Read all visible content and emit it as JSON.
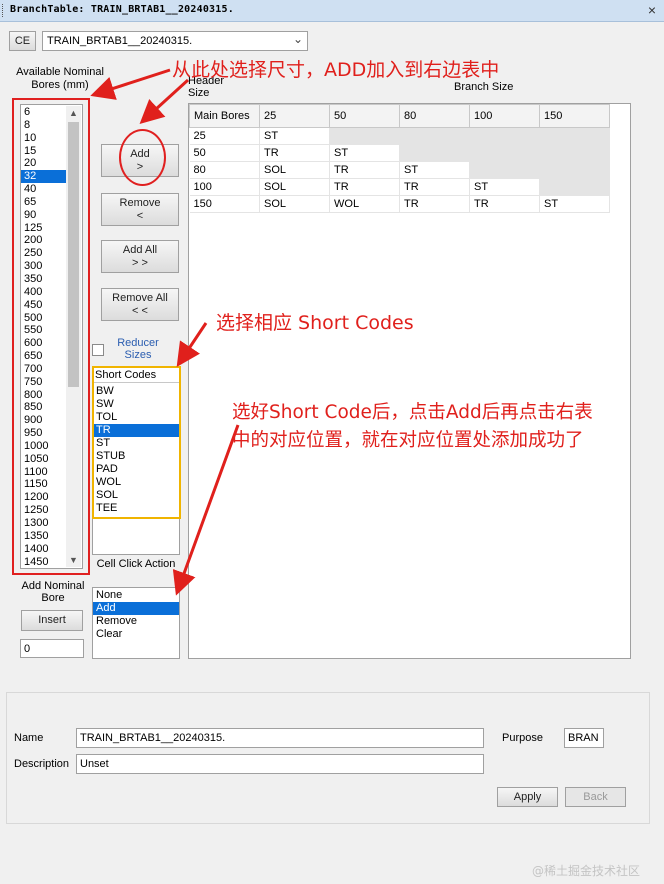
{
  "window": {
    "title": "BranchTable: TRAIN_BRTAB1__20240315.",
    "close": "×"
  },
  "top": {
    "ce_button": "CE",
    "select_value": "TRAIN_BRTAB1__20240315."
  },
  "bores": {
    "label": "Available Nominal Bores (mm)",
    "items": [
      "6",
      "8",
      "10",
      "15",
      "20",
      "32",
      "40",
      "65",
      "90",
      "125",
      "200",
      "250",
      "300",
      "350",
      "400",
      "450",
      "500",
      "550",
      "600",
      "650",
      "700",
      "750",
      "800",
      "850",
      "900",
      "950",
      "1000",
      "1050",
      "1100",
      "1150",
      "1200",
      "1250",
      "1300",
      "1350",
      "1400",
      "1450"
    ],
    "selected_index": 5
  },
  "buttons": {
    "add_line1": "Add",
    "add_line2": ">",
    "remove_line1": "Remove",
    "remove_line2": "<",
    "add_all_line1": "Add All",
    "add_all_line2": "> >",
    "remove_all_line1": "Remove All",
    "remove_all_line2": "< <",
    "insert": "Insert",
    "apply": "Apply",
    "back": "Back"
  },
  "reducer": {
    "label": "Reducer Sizes"
  },
  "short_codes": {
    "header": "Short Codes",
    "items": [
      "BW",
      "SW",
      "TOL",
      "TR",
      "ST",
      "STUB",
      "PAD",
      "WOL",
      "SOL",
      "TEE"
    ],
    "selected_index": 3
  },
  "nominal": {
    "label": "Add Nominal Bore",
    "value": "0"
  },
  "cell_click": {
    "label": "Cell Click Action",
    "items": [
      "None",
      "Add",
      "Remove",
      "Clear"
    ],
    "selected_index": 1
  },
  "grid": {
    "header_size_label": "Header Size",
    "branch_size_label": "Branch Size",
    "columns": [
      "Main Bores",
      "25",
      "50",
      "80",
      "100",
      "150"
    ],
    "rows": [
      [
        "25",
        "ST",
        "",
        "",
        "",
        ""
      ],
      [
        "50",
        "TR",
        "ST",
        "",
        "",
        ""
      ],
      [
        "80",
        "SOL",
        "TR",
        "ST",
        "",
        ""
      ],
      [
        "100",
        "SOL",
        "TR",
        "TR",
        "ST",
        ""
      ],
      [
        "150",
        "SOL",
        "WOL",
        "TR",
        "TR",
        "ST"
      ]
    ]
  },
  "form": {
    "name_label": "Name",
    "name_value": "TRAIN_BRTAB1__20240315.",
    "purpose_label": "Purpose",
    "purpose_value": "BRAN",
    "description_label": "Description",
    "description_value": "Unset"
  },
  "annotations": {
    "a1": "从此处选择尺寸，ADD加入到右边表中",
    "a2": "选择相应 Short Codes",
    "a3_line1": "选好Short Code后，点击Add后再点击右表",
    "a3_line2": "中的对应位置，就在对应位置处添加成功了"
  },
  "watermark": "@稀土掘金技术社区",
  "colors": {
    "annotation_red": "#e0201c",
    "highlight_yellow": "#f0b400",
    "selection_blue": "#0a6fd8"
  }
}
